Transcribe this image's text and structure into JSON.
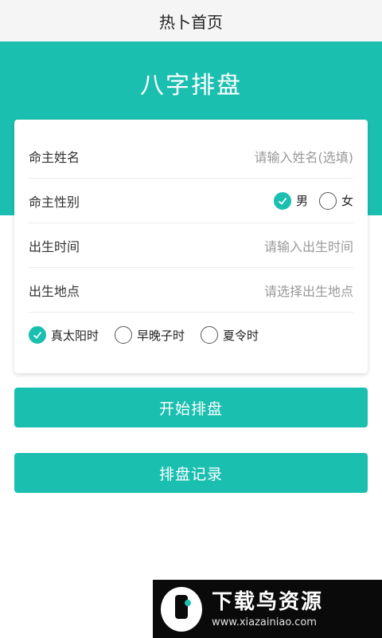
{
  "header": {
    "title": "热卜首页"
  },
  "hero": {
    "title": "八字排盘"
  },
  "form": {
    "name": {
      "label": "命主姓名",
      "placeholder": "请输入姓名(选填)"
    },
    "gender": {
      "label": "命主性别",
      "options": [
        {
          "label": "男",
          "checked": true
        },
        {
          "label": "女",
          "checked": false
        }
      ]
    },
    "birth_time": {
      "label": "出生时间",
      "placeholder": "请输入出生时间"
    },
    "birth_place": {
      "label": "出生地点",
      "placeholder": "请选择出生地点"
    },
    "time_options": [
      {
        "label": "真太阳时",
        "checked": true
      },
      {
        "label": "早晚子时",
        "checked": false
      },
      {
        "label": "夏令时",
        "checked": false
      }
    ]
  },
  "buttons": {
    "start": "开始排盘",
    "history": "排盘记录"
  },
  "watermark": {
    "title": "下载鸟资源",
    "url": "www.xiazainiao.com"
  },
  "colors": {
    "accent": "#1bbfb0",
    "header_bg": "#f5f5f5"
  },
  "icons": {
    "checked": "check-icon",
    "unchecked": "radio-empty-icon"
  }
}
